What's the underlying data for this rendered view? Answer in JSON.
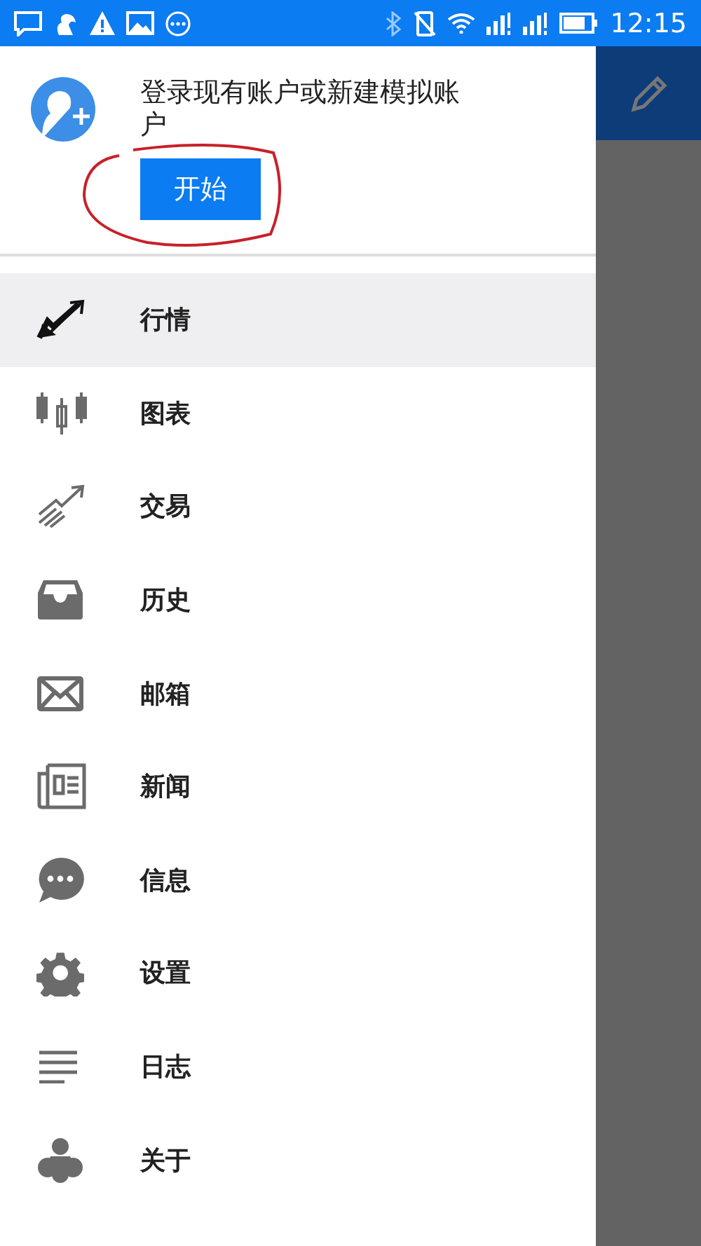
{
  "status_bar": {
    "time": "12:15"
  },
  "drawer": {
    "prompt": "登录现有账户或新建模拟账户",
    "start_button": "开始",
    "items": [
      {
        "label": "行情",
        "kind": "quotes",
        "selected": true
      },
      {
        "label": "图表",
        "kind": "chart",
        "selected": false
      },
      {
        "label": "交易",
        "kind": "trade",
        "selected": false
      },
      {
        "label": "历史",
        "kind": "history",
        "selected": false
      },
      {
        "label": "邮箱",
        "kind": "mail",
        "selected": false
      },
      {
        "label": "新闻",
        "kind": "news",
        "selected": false
      },
      {
        "label": "信息",
        "kind": "chat",
        "selected": false
      },
      {
        "label": "设置",
        "kind": "settings",
        "selected": false
      },
      {
        "label": "日志",
        "kind": "journal",
        "selected": false
      },
      {
        "label": "关于",
        "kind": "about",
        "selected": false
      }
    ]
  }
}
